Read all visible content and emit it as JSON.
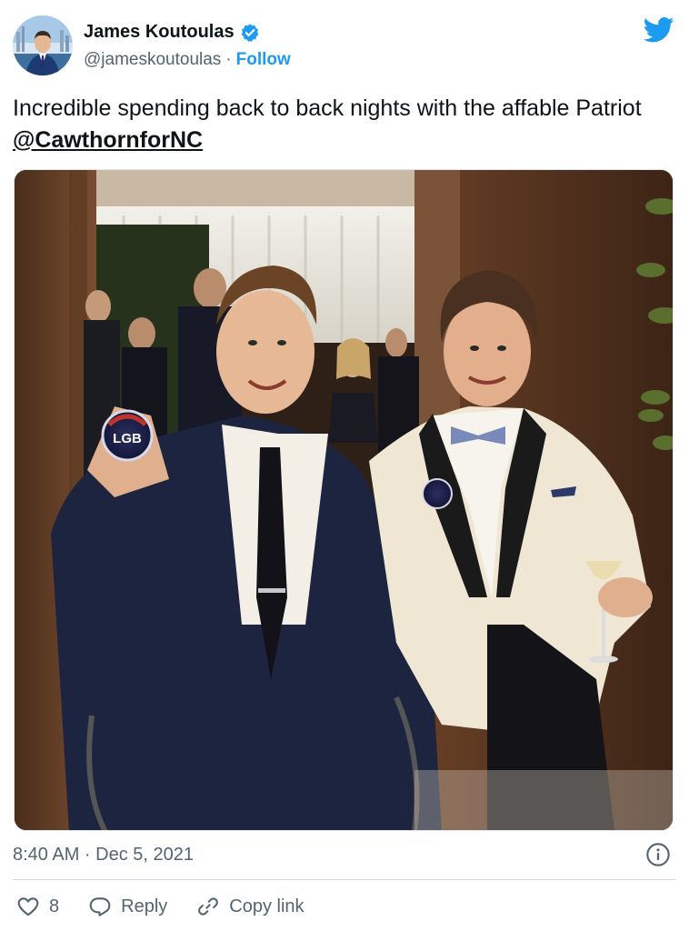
{
  "author": {
    "display_name": "James Koutoulas",
    "handle": "@jameskoutoulas",
    "separator": "·",
    "follow_label": "Follow"
  },
  "tweet": {
    "text_prefix": "Incredible spending back to back nights with the affable Patriot ",
    "mention": "@CawthornforNC",
    "timestamp": "8:40 AM · Dec 5, 2021"
  },
  "photo": {
    "badge_text": "LGB"
  },
  "actions": {
    "like_count": "8",
    "reply_label": "Reply",
    "copy_link_label": "Copy link"
  },
  "icons": {
    "verified": "verified-badge-icon",
    "brand": "twitter-bird-icon",
    "info": "info-icon",
    "like": "heart-icon",
    "reply": "reply-bubble-icon",
    "copy": "link-icon"
  },
  "colors": {
    "accent": "#1d9bf0",
    "text": "#0f1419",
    "muted": "#536471",
    "divider": "#cfd9de"
  }
}
